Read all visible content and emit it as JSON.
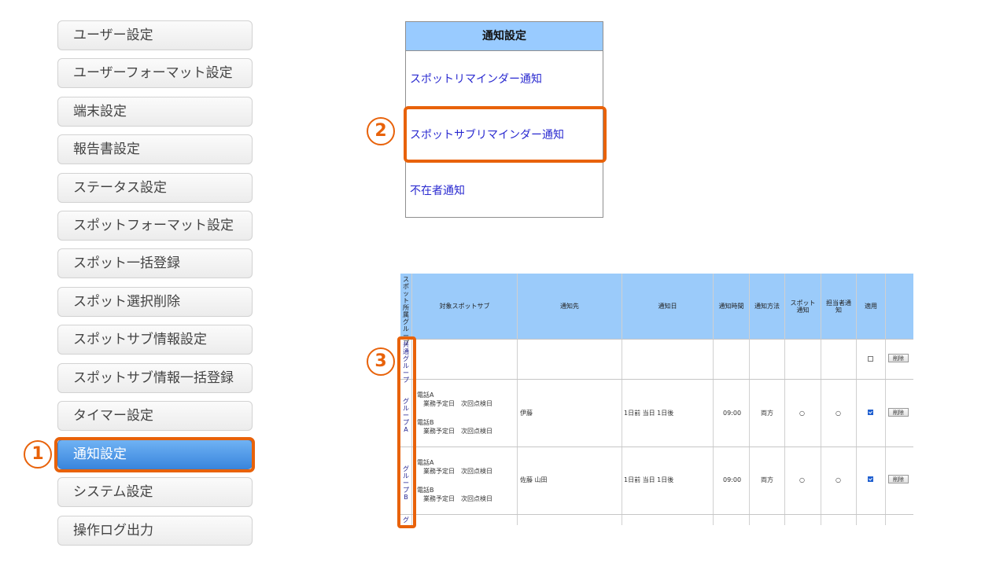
{
  "sidebar": {
    "items": [
      {
        "label": "ユーザー設定"
      },
      {
        "label": "ユーザーフォーマット設定"
      },
      {
        "label": "端末設定"
      },
      {
        "label": "報告書設定"
      },
      {
        "label": "ステータス設定"
      },
      {
        "label": "スポットフォーマット設定"
      },
      {
        "label": "スポット一括登録"
      },
      {
        "label": "スポット選択削除"
      },
      {
        "label": "スポットサブ情報設定"
      },
      {
        "label": "スポットサブ情報一括登録"
      },
      {
        "label": "タイマー設定"
      },
      {
        "label": "通知設定"
      },
      {
        "label": "システム設定"
      },
      {
        "label": "操作ログ出力"
      }
    ],
    "active_index": 11
  },
  "markers": [
    "1",
    "2",
    "3"
  ],
  "notification_menu": {
    "title": "通知設定",
    "links": [
      "スポットリマインダー通知",
      "スポットサブリマインダー通知",
      "不在者通知"
    ]
  },
  "grid": {
    "headers": {
      "group": "スポット所属グループ",
      "target": "対象スポットサブ",
      "recipient": "通知先",
      "notify_day": "通知日",
      "notify_time": "通知時間",
      "method": "通知方法",
      "spot_notify": "スポット通知",
      "assignee_notify": "担当者通知",
      "apply": "適用"
    },
    "rows": [
      {
        "group": "共通グループ",
        "target_lines": [],
        "recipient": "",
        "day": "",
        "time": "",
        "method": "",
        "spot": "",
        "assignee": "",
        "apply": false,
        "delete": "削除"
      },
      {
        "group": "グループA",
        "target_lines": [
          "電話A",
          "　業務予定日　次回点検日",
          "電話B",
          "　業務予定日　次回点検日"
        ],
        "recipient": "伊藤",
        "day": "1日前 当日 1日後",
        "time": "09:00",
        "method": "両方",
        "spot": "○",
        "assignee": "○",
        "apply": true,
        "delete": "削除"
      },
      {
        "group": "グループB",
        "target_lines": [
          "電話A",
          "　業務予定日　次回点検日",
          "電話B",
          "　業務予定日　次回点検日"
        ],
        "recipient": "佐藤 山田",
        "day": "1日前 当日 1日後",
        "time": "09:00",
        "method": "両方",
        "spot": "○",
        "assignee": "○",
        "apply": true,
        "delete": "削除"
      },
      {
        "group": "グ",
        "target_lines": [],
        "recipient": "",
        "day": "",
        "time": "",
        "method": "",
        "spot": "",
        "assignee": "",
        "apply": false,
        "delete": ""
      }
    ]
  }
}
